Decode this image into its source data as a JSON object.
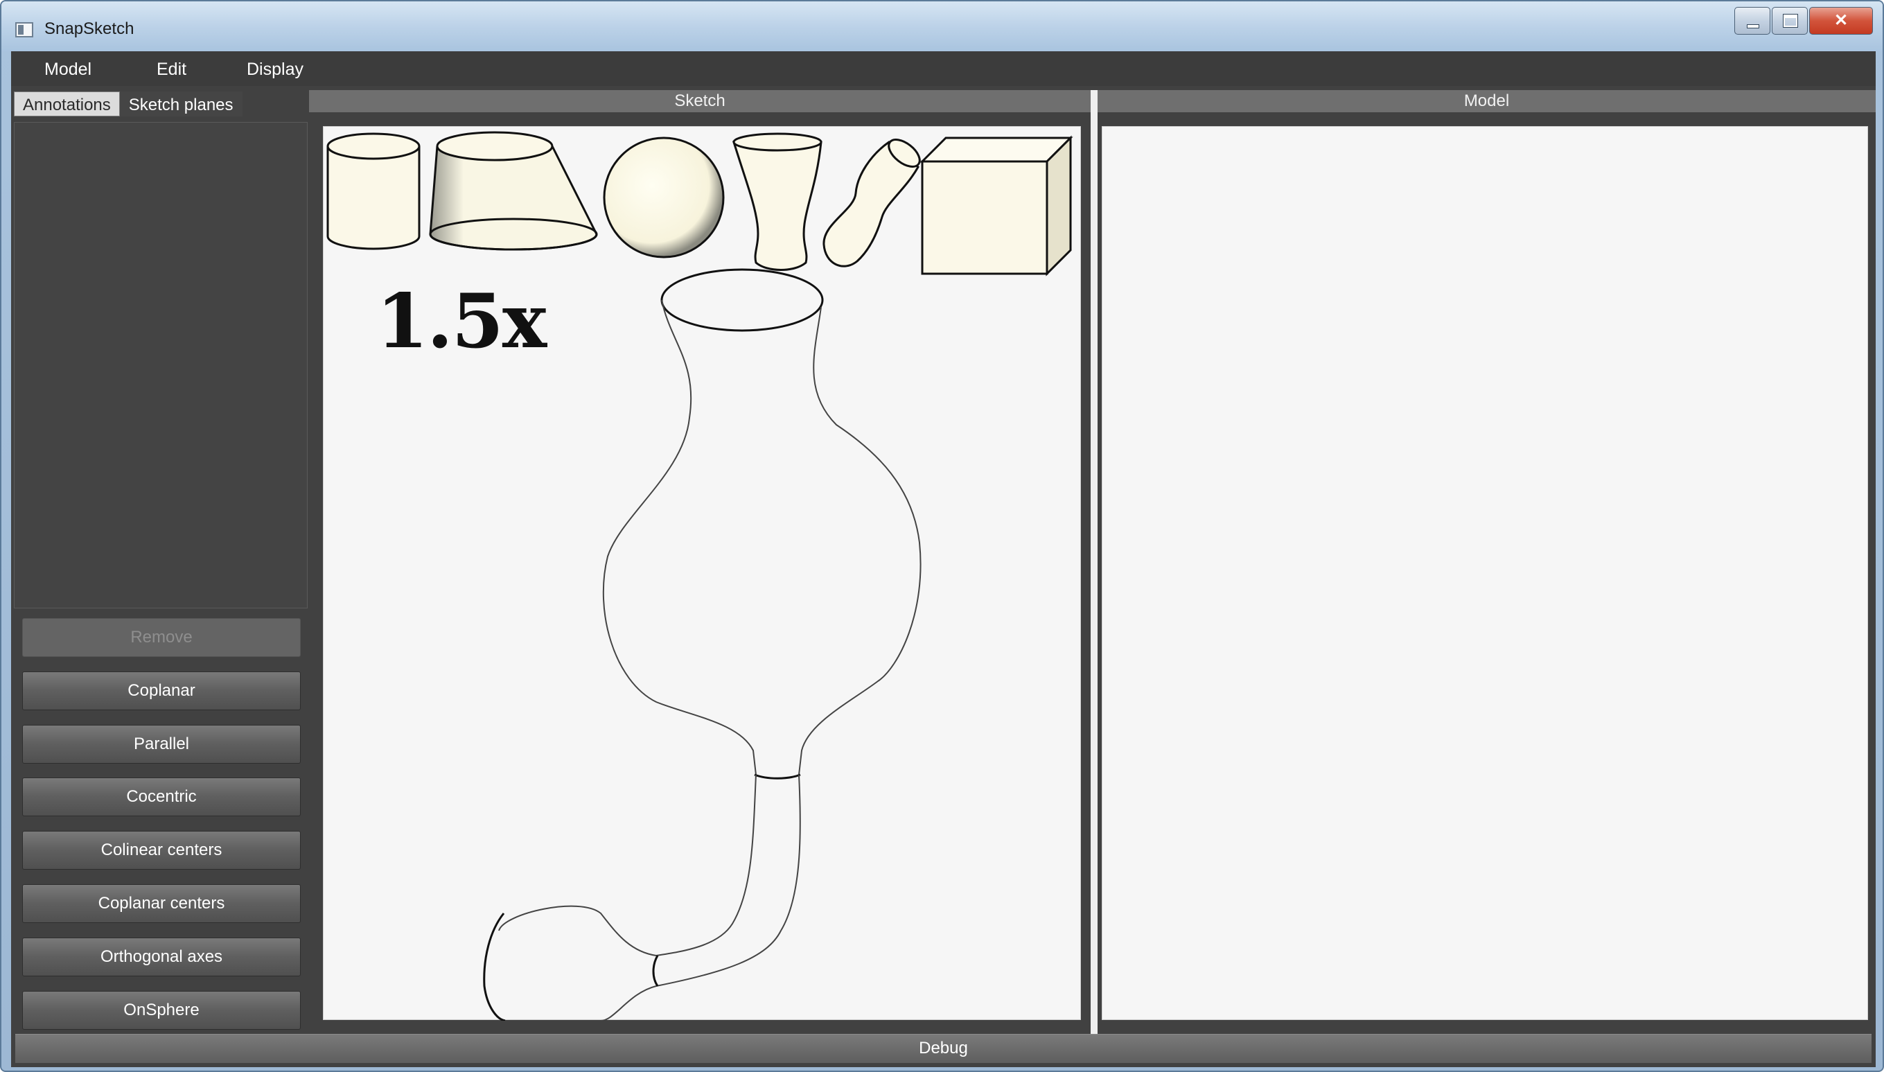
{
  "window": {
    "title": "SnapSketch"
  },
  "menu": [
    "Model",
    "Edit",
    "Display"
  ],
  "tabs": {
    "annotations": "Annotations",
    "sketch_planes": "Sketch planes"
  },
  "commands": {
    "remove": "Remove",
    "coplanar": "Coplanar",
    "parallel": "Parallel",
    "cocentric": "Cocentric",
    "colinear_centers": "Colinear centers",
    "coplanar_centers": "Coplanar centers",
    "orthogonal_axes": "Orthogonal axes",
    "onsphere": "OnSphere"
  },
  "panes": {
    "sketch": "Sketch",
    "model": "Model"
  },
  "sketch": {
    "zoom_label": "1.5x",
    "primitives": [
      "cylinder",
      "truncated-cone",
      "sphere",
      "hourglass-cup",
      "bent-tube",
      "cube"
    ]
  },
  "debug": {
    "label": "Debug"
  },
  "colors": {
    "primitive_fill": "#fbf8e8",
    "pane_bg": "#f6f6f6",
    "panel_bg": "#414141"
  }
}
